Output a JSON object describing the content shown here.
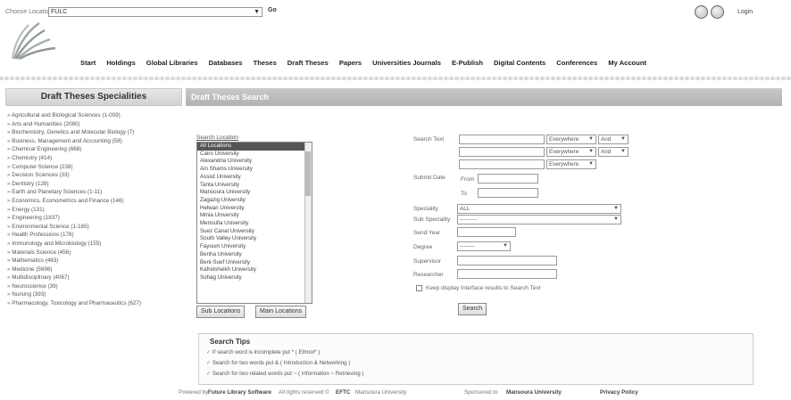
{
  "topbar": {
    "lang_label": "Choose Location",
    "lang_value": "FULC",
    "go_label": "Go",
    "login_label": "Login"
  },
  "nav": {
    "items": [
      "Start",
      "Holdings",
      "Global Libraries",
      "Databases",
      "Theses",
      "Draft Theses",
      "Papers",
      "Universities Journals",
      "E-Publish",
      "Digital Contents",
      "Conferences",
      "My Account"
    ]
  },
  "sidebar": {
    "title": "Draft Theses Specialities",
    "items": [
      "Agricultural and Biological Sciences (1-009)",
      "Arts and Humanities (2080)",
      "Biochemistry, Genetics and Molecular Biology (7)",
      "Business, Management and Accounting (58)",
      "Chemical Engineering (668)",
      "Chemistry (414)",
      "Computer Science (238)",
      "Decision Sciences (33)",
      "Dentistry (128)",
      "Earth and Planetary Sciences (1-11)",
      "Economics, Econometrics and Finance (146)",
      "Energy (131)",
      "Engineering (1837)",
      "Environmental Science (1-165)",
      "Health Professions (176)",
      "Immunology and Microbiology (155)",
      "Materials Science (456)",
      "Mathematics (483)",
      "Medicine (5696)",
      "Multidisciplinary (4067)",
      "Neuroscience (39)",
      "Nursing (393)",
      "Pharmacology, Toxicology and Pharmaceutics (627)"
    ]
  },
  "main": {
    "header": "Draft Theses Search",
    "location_label": "Search Location",
    "locations": [
      "All Locations",
      "Cairo University",
      "Alexandria University",
      "Ain Shams University",
      "Assiut University",
      "Tanta University",
      "Mansoura University",
      "Zagazig University",
      "Helwan University",
      "Minia University",
      "Menoufia University",
      "Suez Canal University",
      "South Valley University",
      "Fayoum University",
      "Benha University",
      "Beni-Suef University",
      "Kafrelsheikh University",
      "Sohag University"
    ],
    "sub_locations_label": "Sub Locations",
    "main_locations_label": "Main Locations",
    "search_text_label": "Search Text",
    "where_option": "Everywhere",
    "and_option": "And",
    "submit_date_label": "Submit Date",
    "from_label": "From",
    "to_label": "To",
    "speciality_label": "Speciality",
    "speciality_value": "ALL",
    "sub_speciality_label": "Sub Speciality",
    "sub_speciality_value": "---------",
    "send_year_label": "Send Year",
    "degree_label": "Degree",
    "degree_value": "--------",
    "supervisor_label": "Supervisor",
    "researcher_label": "Researcher",
    "checkbox_label": "Keep display Interface results to Search Text",
    "search_button": "Search"
  },
  "tips": {
    "title": "Search Tips",
    "items": [
      "If search word is incomplete put * ( Ethnol* )",
      "Search for two words put & ( Introduction & Networking )",
      "Search for two related words put ~ ( Information ~ Retrieving )"
    ]
  },
  "footer": {
    "powered": "Powered by",
    "product": "Future Library Software",
    "rights": "All rights reserved ©",
    "brand": "EFTC",
    "univ_small": "Mansoura University",
    "sponsored": "Sponsored to",
    "sponsor": "Mansoura University",
    "privacy": "Privacy Policy"
  }
}
